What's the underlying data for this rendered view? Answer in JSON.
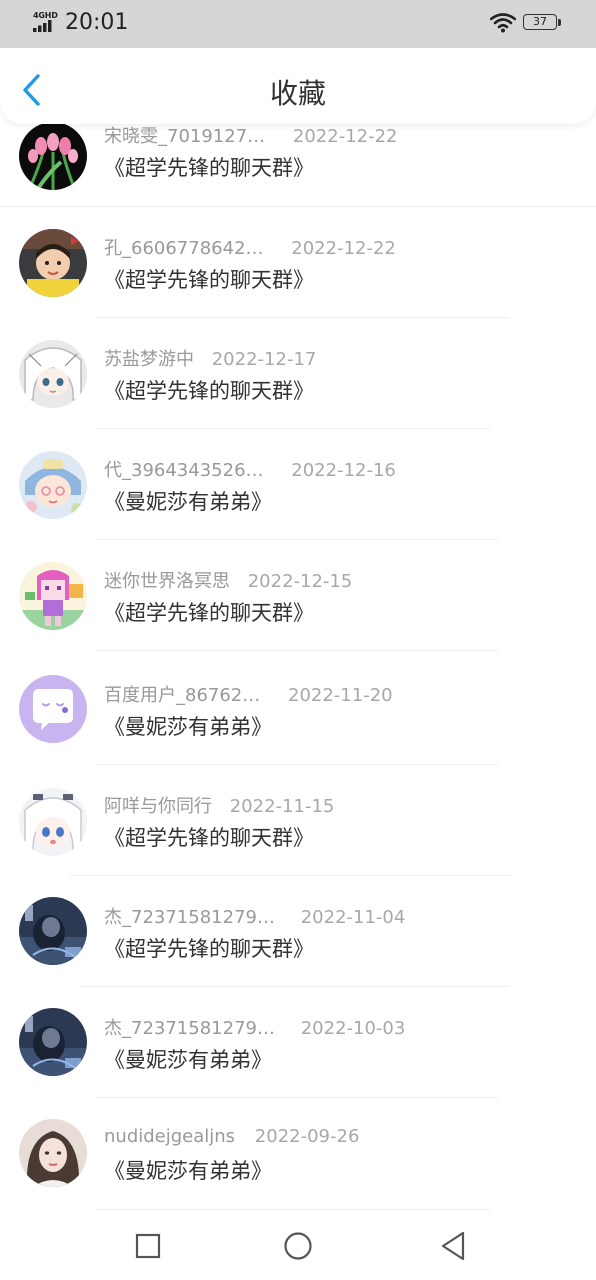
{
  "status_bar": {
    "network": "4GHD",
    "time": "20:01",
    "battery": "37"
  },
  "header": {
    "title": "收藏",
    "back_icon": "chevron-left-icon"
  },
  "favorites": [
    {
      "name": "宋晓雯_7019127…",
      "date": "2022-12-22",
      "group": "《超学先锋的聊天群》",
      "avatar": "tulip-photo"
    },
    {
      "name": "孔_6606778642…",
      "date": "2022-12-22",
      "group": "《超学先锋的聊天群》",
      "avatar": "child-photo"
    },
    {
      "name": "苏盐梦游中",
      "date": "2022-12-17",
      "group": "《超学先锋的聊天群》",
      "avatar": "anime-girl"
    },
    {
      "name": "代_3964343526…",
      "date": "2022-12-16",
      "group": "《曼妮莎有弟弟》",
      "avatar": "cartoon-character"
    },
    {
      "name": "迷你世界洛冥思",
      "date": "2022-12-15",
      "group": "《超学先锋的聊天群》",
      "avatar": "game-character"
    },
    {
      "name": "百度用户_86762…",
      "date": "2022-11-20",
      "group": "《曼妮莎有弟弟》",
      "avatar": "chat-bubble-default"
    },
    {
      "name": "阿咩与你同行",
      "date": "2022-11-15",
      "group": "《超学先锋的聊天群》",
      "avatar": "anime-girl-white-hair"
    },
    {
      "name": "杰_72371581279…",
      "date": "2022-11-04",
      "group": "《超学先锋的聊天群》",
      "avatar": "dark-artwork"
    },
    {
      "name": "杰_72371581279…",
      "date": "2022-10-03",
      "group": "《曼妮莎有弟弟》",
      "avatar": "dark-artwork"
    },
    {
      "name": "nudidejgealjns",
      "date": "2022-09-26",
      "group": "《曼妮莎有弟弟》",
      "avatar": "portrait-photo"
    }
  ],
  "nav_bar": {
    "recents_icon": "square-icon",
    "home_icon": "circle-icon",
    "back_icon": "triangle-back-icon"
  },
  "colors": {
    "accent": "#1e9be8",
    "status_bar_bg": "#d6d6d6",
    "meta_text": "#999999",
    "body_text": "#333333"
  }
}
